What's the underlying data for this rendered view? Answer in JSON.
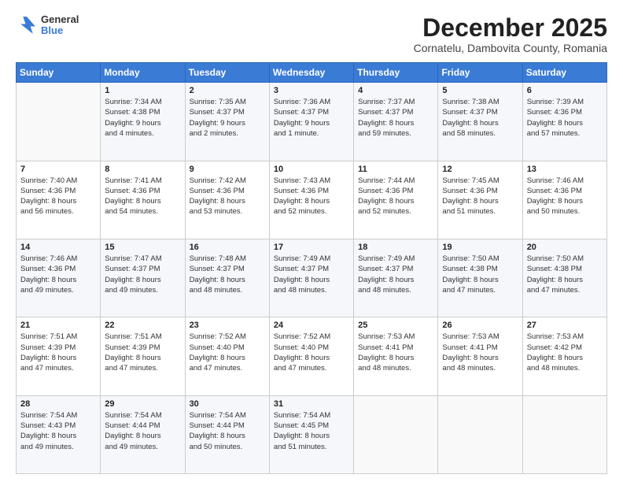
{
  "logo": {
    "general": "General",
    "blue": "Blue"
  },
  "header": {
    "month": "December 2025",
    "location": "Cornatelu, Dambovita County, Romania"
  },
  "days_of_week": [
    "Sunday",
    "Monday",
    "Tuesday",
    "Wednesday",
    "Thursday",
    "Friday",
    "Saturday"
  ],
  "weeks": [
    [
      {
        "day": "",
        "info": ""
      },
      {
        "day": "1",
        "info": "Sunrise: 7:34 AM\nSunset: 4:38 PM\nDaylight: 9 hours\nand 4 minutes."
      },
      {
        "day": "2",
        "info": "Sunrise: 7:35 AM\nSunset: 4:37 PM\nDaylight: 9 hours\nand 2 minutes."
      },
      {
        "day": "3",
        "info": "Sunrise: 7:36 AM\nSunset: 4:37 PM\nDaylight: 9 hours\nand 1 minute."
      },
      {
        "day": "4",
        "info": "Sunrise: 7:37 AM\nSunset: 4:37 PM\nDaylight: 8 hours\nand 59 minutes."
      },
      {
        "day": "5",
        "info": "Sunrise: 7:38 AM\nSunset: 4:37 PM\nDaylight: 8 hours\nand 58 minutes."
      },
      {
        "day": "6",
        "info": "Sunrise: 7:39 AM\nSunset: 4:36 PM\nDaylight: 8 hours\nand 57 minutes."
      }
    ],
    [
      {
        "day": "7",
        "info": "Sunrise: 7:40 AM\nSunset: 4:36 PM\nDaylight: 8 hours\nand 56 minutes."
      },
      {
        "day": "8",
        "info": "Sunrise: 7:41 AM\nSunset: 4:36 PM\nDaylight: 8 hours\nand 54 minutes."
      },
      {
        "day": "9",
        "info": "Sunrise: 7:42 AM\nSunset: 4:36 PM\nDaylight: 8 hours\nand 53 minutes."
      },
      {
        "day": "10",
        "info": "Sunrise: 7:43 AM\nSunset: 4:36 PM\nDaylight: 8 hours\nand 52 minutes."
      },
      {
        "day": "11",
        "info": "Sunrise: 7:44 AM\nSunset: 4:36 PM\nDaylight: 8 hours\nand 52 minutes."
      },
      {
        "day": "12",
        "info": "Sunrise: 7:45 AM\nSunset: 4:36 PM\nDaylight: 8 hours\nand 51 minutes."
      },
      {
        "day": "13",
        "info": "Sunrise: 7:46 AM\nSunset: 4:36 PM\nDaylight: 8 hours\nand 50 minutes."
      }
    ],
    [
      {
        "day": "14",
        "info": "Sunrise: 7:46 AM\nSunset: 4:36 PM\nDaylight: 8 hours\nand 49 minutes."
      },
      {
        "day": "15",
        "info": "Sunrise: 7:47 AM\nSunset: 4:37 PM\nDaylight: 8 hours\nand 49 minutes."
      },
      {
        "day": "16",
        "info": "Sunrise: 7:48 AM\nSunset: 4:37 PM\nDaylight: 8 hours\nand 48 minutes."
      },
      {
        "day": "17",
        "info": "Sunrise: 7:49 AM\nSunset: 4:37 PM\nDaylight: 8 hours\nand 48 minutes."
      },
      {
        "day": "18",
        "info": "Sunrise: 7:49 AM\nSunset: 4:37 PM\nDaylight: 8 hours\nand 48 minutes."
      },
      {
        "day": "19",
        "info": "Sunrise: 7:50 AM\nSunset: 4:38 PM\nDaylight: 8 hours\nand 47 minutes."
      },
      {
        "day": "20",
        "info": "Sunrise: 7:50 AM\nSunset: 4:38 PM\nDaylight: 8 hours\nand 47 minutes."
      }
    ],
    [
      {
        "day": "21",
        "info": "Sunrise: 7:51 AM\nSunset: 4:39 PM\nDaylight: 8 hours\nand 47 minutes."
      },
      {
        "day": "22",
        "info": "Sunrise: 7:51 AM\nSunset: 4:39 PM\nDaylight: 8 hours\nand 47 minutes."
      },
      {
        "day": "23",
        "info": "Sunrise: 7:52 AM\nSunset: 4:40 PM\nDaylight: 8 hours\nand 47 minutes."
      },
      {
        "day": "24",
        "info": "Sunrise: 7:52 AM\nSunset: 4:40 PM\nDaylight: 8 hours\nand 47 minutes."
      },
      {
        "day": "25",
        "info": "Sunrise: 7:53 AM\nSunset: 4:41 PM\nDaylight: 8 hours\nand 48 minutes."
      },
      {
        "day": "26",
        "info": "Sunrise: 7:53 AM\nSunset: 4:41 PM\nDaylight: 8 hours\nand 48 minutes."
      },
      {
        "day": "27",
        "info": "Sunrise: 7:53 AM\nSunset: 4:42 PM\nDaylight: 8 hours\nand 48 minutes."
      }
    ],
    [
      {
        "day": "28",
        "info": "Sunrise: 7:54 AM\nSunset: 4:43 PM\nDaylight: 8 hours\nand 49 minutes."
      },
      {
        "day": "29",
        "info": "Sunrise: 7:54 AM\nSunset: 4:44 PM\nDaylight: 8 hours\nand 49 minutes."
      },
      {
        "day": "30",
        "info": "Sunrise: 7:54 AM\nSunset: 4:44 PM\nDaylight: 8 hours\nand 50 minutes."
      },
      {
        "day": "31",
        "info": "Sunrise: 7:54 AM\nSunset: 4:45 PM\nDaylight: 8 hours\nand 51 minutes."
      },
      {
        "day": "",
        "info": ""
      },
      {
        "day": "",
        "info": ""
      },
      {
        "day": "",
        "info": ""
      }
    ]
  ]
}
